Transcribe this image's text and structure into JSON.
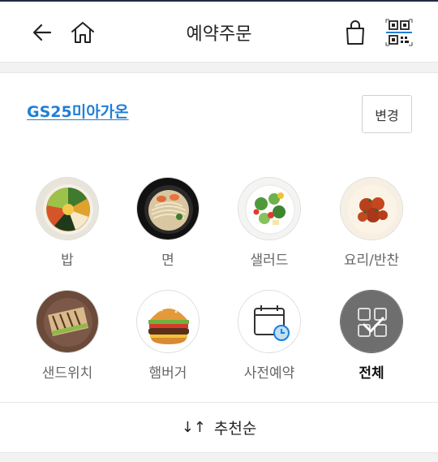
{
  "header": {
    "title": "예약주문",
    "back_icon": "arrow-left-icon",
    "home_icon": "home-icon",
    "bag_icon": "shopping-bag-icon",
    "qr_icon": "qr-code-icon"
  },
  "store": {
    "name": "GS25미아가온",
    "change_label": "변경",
    "accent_color": "#1f7fd8"
  },
  "categories": [
    {
      "label": "밥",
      "icon": "bibimbap-image"
    },
    {
      "label": "면",
      "icon": "noodle-image"
    },
    {
      "label": "샐러드",
      "icon": "salad-image"
    },
    {
      "label": "요리/반찬",
      "icon": "side-dish-image"
    },
    {
      "label": "샌드위치",
      "icon": "sandwich-image"
    },
    {
      "label": "햄버거",
      "icon": "hamburger-image"
    },
    {
      "label": "사전예약",
      "icon": "calendar-clock-icon"
    },
    {
      "label": "전체",
      "icon": "grid-check-icon",
      "selected": true
    }
  ],
  "sort": {
    "label": "추천순",
    "icon": "sort-arrows-icon"
  }
}
